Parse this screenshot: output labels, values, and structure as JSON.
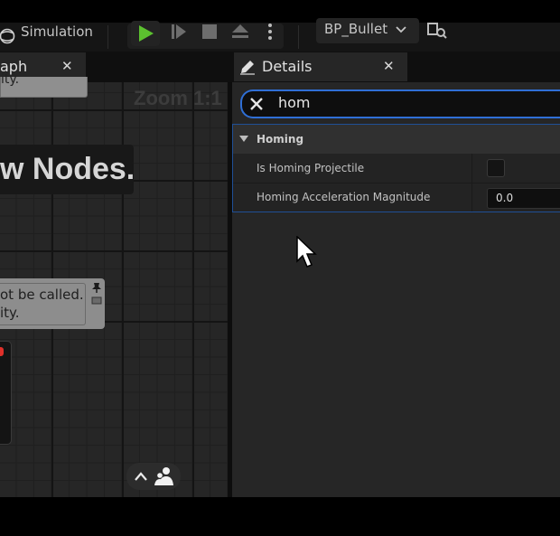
{
  "toolbar": {
    "simulation_label": "Simulation",
    "blueprint_name": "BP_Bullet"
  },
  "tabs": {
    "graph_label": "aph",
    "details_label": "Details"
  },
  "graph": {
    "zoom_label": "Zoom 1:1",
    "comment_top_text": "ity.",
    "big_title_text": "w Nodes.",
    "comment_line1": "ot be called.",
    "comment_line2": "ity."
  },
  "details": {
    "search_value": "hom",
    "category_label": "Homing",
    "properties": [
      {
        "label": "Is Homing Projectile",
        "value": ""
      },
      {
        "label": "Homing Acceleration Magnitude",
        "value": "0.0"
      }
    ]
  },
  "colors": {
    "play_green": "#5cc12f",
    "accent_blue": "#2f6fd6",
    "selection_blue": "#1f4f96"
  }
}
